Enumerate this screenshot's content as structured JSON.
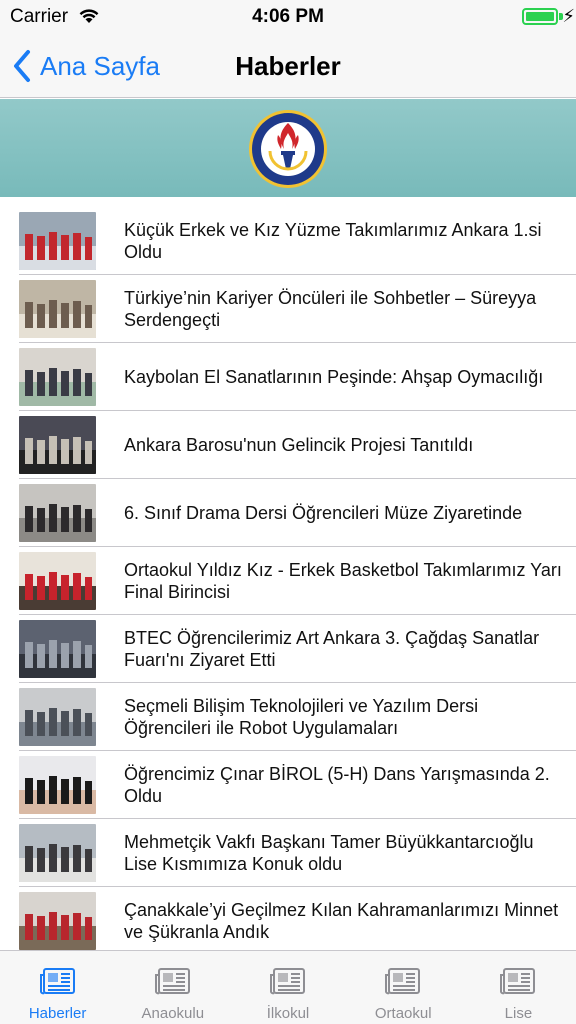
{
  "status_bar": {
    "carrier": "Carrier",
    "time": "4:06 PM",
    "battery_charging": true,
    "accent_color": "#2bd150"
  },
  "nav": {
    "back_label": "Ana Sayfa",
    "title": "Haberler",
    "accent_color": "#1a7cf5"
  },
  "banner": {
    "logo": "school-emblem-icon",
    "logo_text": "TED ANKARA KOLEJİ"
  },
  "news": [
    {
      "title": "Küçük Erkek ve Kız Yüzme Takımlarımız Ankara 1.si Oldu",
      "thumb_colors": [
        "#9aa7b4",
        "#c2272d",
        "#d9dde3"
      ]
    },
    {
      "title": "Türkiye’nin Kariyer Öncüleri ile Sohbetler – Süreyya Serdengeçti",
      "thumb_colors": [
        "#bfb6a5",
        "#6d5d4f",
        "#e6e0d4"
      ]
    },
    {
      "title": "Kaybolan El Sanatlarının Peşinde: Ahşap Oymacılığı",
      "thumb_colors": [
        "#d9d5cf",
        "#3a3b45",
        "#a0b9a6"
      ]
    },
    {
      "title": "Ankara Barosu'nun Gelincik Projesi Tanıtıldı",
      "thumb_colors": [
        "#4a4a55",
        "#c6c0b6",
        "#222"
      ]
    },
    {
      "title": "6. Sınıf Drama Dersi Öğrencileri Müze Ziyaretinde",
      "thumb_colors": [
        "#c6c4c0",
        "#2c2a2c",
        "#8c8a86"
      ]
    },
    {
      "title": "Ortaokul Yıldız Kız - Erkek Basketbol Takımlarımız Yarı Final Birincisi",
      "thumb_colors": [
        "#e8e3da",
        "#c7232c",
        "#4a3c34"
      ]
    },
    {
      "title": "BTEC Öğrencilerimiz Art Ankara 3. Çağdaş Sanatlar Fuarı'nı Ziyaret Etti",
      "thumb_colors": [
        "#5c6270",
        "#9ba2ad",
        "#30343c"
      ]
    },
    {
      "title": "Seçmeli Bilişim Teknolojileri ve Yazılım Dersi Öğrencileri ile Robot Uygulamaları",
      "thumb_colors": [
        "#c9cbcd",
        "#4b5058",
        "#7e8690"
      ]
    },
    {
      "title": "Öğrencimiz Çınar BİROL (5-H) Dans Yarışmasında 2. Oldu",
      "thumb_colors": [
        "#e9e9ec",
        "#1a1a1a",
        "#d9b9a4"
      ]
    },
    {
      "title": "Mehmetçik Vakfı Başkanı Tamer Büyükkantarcıoğlu Lise Kısmımıza Konuk oldu",
      "thumb_colors": [
        "#b5bcc3",
        "#3b3a3d",
        "#e2e2e0"
      ]
    },
    {
      "title": "Çanakkale’yi Geçilmez Kılan Kahramanlarımızı Minnet ve Şükranla Andık",
      "thumb_colors": [
        "#d8d4cf",
        "#b8262d",
        "#7a6a58"
      ]
    }
  ],
  "tabs": [
    {
      "label": "Haberler",
      "icon": "newspaper-icon",
      "active": true
    },
    {
      "label": "Anaokulu",
      "icon": "newspaper-icon",
      "active": false
    },
    {
      "label": "İlkokul",
      "icon": "newspaper-icon",
      "active": false
    },
    {
      "label": "Ortaokul",
      "icon": "newspaper-icon",
      "active": false
    },
    {
      "label": "Lise",
      "icon": "newspaper-icon",
      "active": false
    }
  ]
}
